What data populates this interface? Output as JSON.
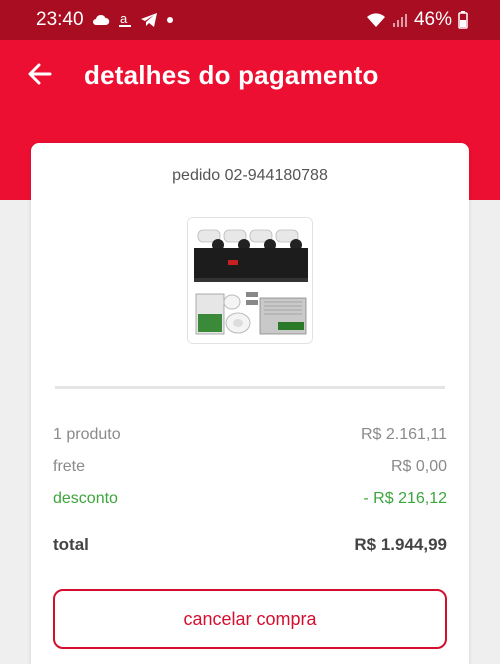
{
  "status_bar": {
    "time": "23:40",
    "battery": "46%"
  },
  "header": {
    "title": "detalhes do pagamento"
  },
  "order": {
    "label": "pedido 02-944180788"
  },
  "summary": {
    "products_label": "1 produto",
    "products_value": "R$ 2.161,11",
    "shipping_label": "frete",
    "shipping_value": "R$ 0,00",
    "discount_label": "desconto",
    "discount_value": "- R$ 216,12",
    "total_label": "total",
    "total_value": "R$ 1.944,99"
  },
  "actions": {
    "cancel_label": "cancelar compra"
  },
  "colors": {
    "header_red": "#ec0f32",
    "status_bar": "#a80d22",
    "discount_green": "#3da53d",
    "button_red": "#d40f2e"
  }
}
